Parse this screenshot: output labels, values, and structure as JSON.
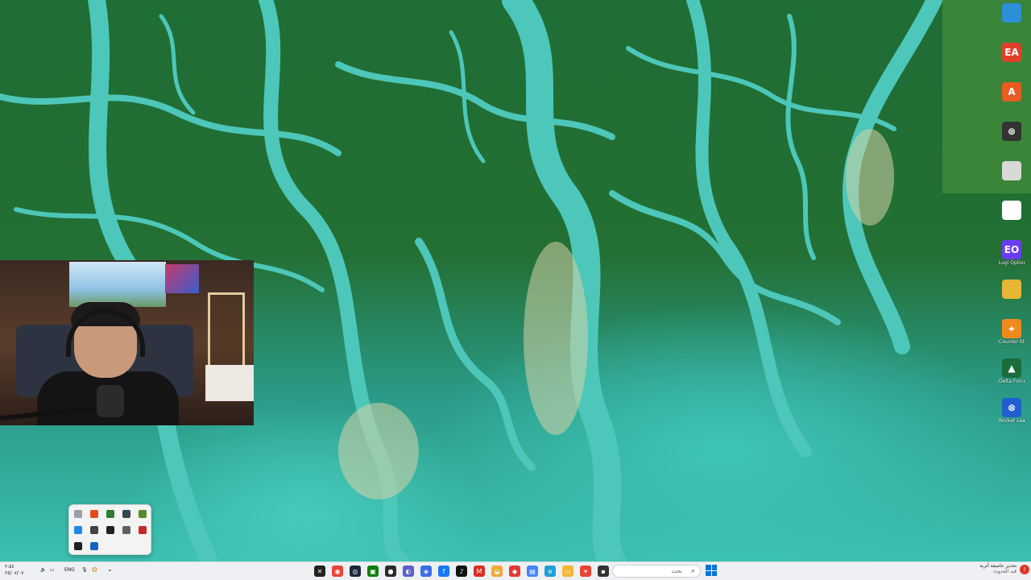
{
  "desktop": {
    "icons": [
      {
        "name": "desktop-icon-1",
        "label": "",
        "color": "#2d8fd6",
        "glyph": ""
      },
      {
        "name": "ea-app-icon",
        "label": "",
        "color": "#e0402a",
        "glyph": "EA"
      },
      {
        "name": "arma-icon",
        "label": "",
        "color": "#e85c22",
        "glyph": "A"
      },
      {
        "name": "desktop-icon-4",
        "label": "",
        "color": "#333333",
        "glyph": "⊛"
      },
      {
        "name": "desktop-icon-5",
        "label": "",
        "color": "#d8d8d8",
        "glyph": ""
      },
      {
        "name": "desktop-icon-6",
        "label": "",
        "color": "#ffffff",
        "glyph": ""
      },
      {
        "name": "logi-options-icon",
        "label": "Logi Options+",
        "color": "#6a3df0",
        "glyph": "EO"
      },
      {
        "name": "desktop-icon-8",
        "label": "",
        "color": "#e7b634",
        "glyph": ""
      },
      {
        "name": "counter-strike-icon",
        "label": "Counter-Strike 2",
        "color": "#f08a1c",
        "glyph": "⌖"
      },
      {
        "name": "delta-force-icon",
        "label": "Delta Force",
        "color": "#1a6d3a",
        "glyph": "▲"
      },
      {
        "name": "rocket-league-icon",
        "label": "Rocket League",
        "color": "#1f5fcf",
        "glyph": "⊗"
      }
    ]
  },
  "tray_popup": {
    "icons": [
      {
        "name": "tray-icon-1",
        "color": "#9aa0a6"
      },
      {
        "name": "tray-icon-2",
        "color": "#e64a19"
      },
      {
        "name": "tray-icon-3",
        "color": "#2e7d32"
      },
      {
        "name": "tray-icon-4",
        "color": "#37474f"
      },
      {
        "name": "tray-icon-5",
        "color": "#558b2f"
      },
      {
        "name": "tray-icon-6",
        "color": "#1e88e5"
      },
      {
        "name": "tray-icon-7",
        "color": "#424242"
      },
      {
        "name": "tray-icon-8",
        "color": "#212121"
      },
      {
        "name": "tray-icon-9",
        "color": "#616161"
      },
      {
        "name": "tray-icon-10",
        "color": "#c62828"
      },
      {
        "name": "tray-icon-11",
        "color": "#212121"
      },
      {
        "name": "bluetooth-icon",
        "color": "#1565c0"
      }
    ]
  },
  "taskbar": {
    "tray_left": {
      "time": "٢:٥٤",
      "date": "٢٥/٠٧/٠٧",
      "language": "ENG"
    },
    "apps": [
      {
        "name": "capcut-taskbar-icon",
        "color": "#222222",
        "glyph": "✕"
      },
      {
        "name": "chrome-taskbar-icon",
        "color": "#e8453c",
        "glyph": "◉"
      },
      {
        "name": "steam-taskbar-icon",
        "color": "#1b2838",
        "glyph": "◎"
      },
      {
        "name": "xbox-taskbar-icon",
        "color": "#107c10",
        "glyph": "▣"
      },
      {
        "name": "obs-taskbar-icon",
        "color": "#2b2b2b",
        "glyph": "●"
      },
      {
        "name": "app-taskbar-icon-6",
        "color": "#5b5fc7",
        "glyph": "◐"
      },
      {
        "name": "app-taskbar-icon-7",
        "color": "#3b6ee8",
        "glyph": "◈"
      },
      {
        "name": "facebook-taskbar-icon",
        "color": "#1877f2",
        "glyph": "f"
      },
      {
        "name": "tiktok-taskbar-icon",
        "color": "#111111",
        "glyph": "♪"
      },
      {
        "name": "gmail-taskbar-icon",
        "color": "#d93025",
        "glyph": "M"
      },
      {
        "name": "app-taskbar-icon-11",
        "color": "#f2a93b",
        "glyph": "◒"
      },
      {
        "name": "app-taskbar-icon-12",
        "color": "#e53935",
        "glyph": "◆"
      },
      {
        "name": "app-taskbar-icon-13",
        "color": "#4285f4",
        "glyph": "▤"
      },
      {
        "name": "edge-taskbar-icon",
        "color": "#1fa0d8",
        "glyph": "e"
      },
      {
        "name": "explorer-taskbar-icon",
        "color": "#f2b632",
        "glyph": "▭"
      },
      {
        "name": "app-taskbar-icon-16",
        "color": "#ea4335",
        "glyph": "✦"
      },
      {
        "name": "app-taskbar-icon-17",
        "color": "#333333",
        "glyph": "▪"
      }
    ],
    "search_placeholder": "بحث",
    "notification": {
      "line1": "تحذير عاصفة أترية",
      "line2": "قيد الحدوث",
      "badge": "!"
    }
  }
}
